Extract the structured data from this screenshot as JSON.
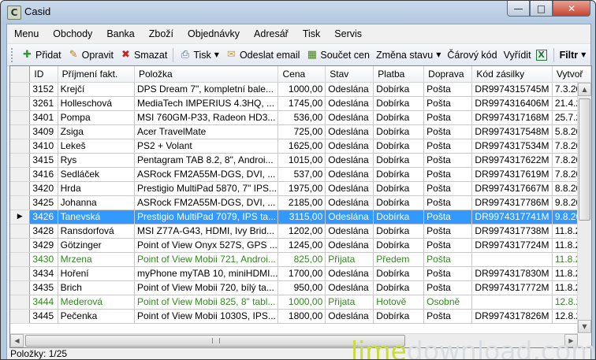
{
  "window": {
    "title": "Casid",
    "app_icon": "C",
    "controls": [
      "minimize-icon",
      "maximize-icon",
      "close-icon"
    ]
  },
  "menu": [
    "Menu",
    "Obchody",
    "Banka",
    "Zboží",
    "Objednávky",
    "Adresář",
    "Tisk",
    "Servis"
  ],
  "toolbar": {
    "add": "Přidat",
    "edit": "Opravit",
    "delete": "Smazat",
    "print": "Tisk",
    "send_email": "Odeslat email",
    "sum_prices": "Součet cen",
    "change_state": "Změna stavu",
    "barcode": "Čárový kód",
    "resolve": "Vyřídit",
    "filter": "Filtr"
  },
  "columns": [
    "ID",
    "Příjmení fakt.",
    "Položka",
    "Cena",
    "Stav",
    "Platba",
    "Doprava",
    "Kód zásilky",
    "Vytvoř"
  ],
  "rows": [
    [
      "3152",
      "Krejčí",
      "DPS Dream 7\", kompletní bale...",
      "1000,00",
      "Odeslána",
      "Dobírka",
      "Pošta",
      "DR9974315745M",
      "7.3.201"
    ],
    [
      "3261",
      "Holleschová",
      "MediaTech IMPERIUS 4.3HQ, ...",
      "1745,00",
      "Odeslána",
      "Dobírka",
      "Pošta",
      "DR9974316406M",
      "21.4.20"
    ],
    [
      "3401",
      "Pompa",
      "MSI 760GM-P33, Radeon HD3...",
      "536,00",
      "Odeslána",
      "Dobírka",
      "Pošta",
      "DR9974317168M",
      "25.7.20"
    ],
    [
      "3409",
      "Zsiga",
      "Acer TravelMate",
      "725,00",
      "Odeslána",
      "Dobírka",
      "Pošta",
      "DR9974317548M",
      "5.8.201"
    ],
    [
      "3410",
      "Lekeš",
      "PS2 + Volant",
      "1625,00",
      "Odeslána",
      "Dobírka",
      "Pošta",
      "DR9974317534M",
      "7.8.201"
    ],
    [
      "3415",
      "Rys",
      "Pentagram TAB 8.2, 8\", Androi...",
      "1015,00",
      "Odeslána",
      "Dobírka",
      "Pošta",
      "DR9974317622M",
      "7.8.201"
    ],
    [
      "3416",
      "Sedláček",
      "ASRock FM2A55M-DGS, DVI, ...",
      "537,00",
      "Odeslána",
      "Dobírka",
      "Pošta",
      "DR9974317619M",
      "7.8.201"
    ],
    [
      "3420",
      "Hrda",
      "Prestigio MultiPad 5870, 7\" IPS...",
      "1975,00",
      "Odeslána",
      "Dobírka",
      "Pošta",
      "DR9974317667M",
      "8.8.201"
    ],
    [
      "3425",
      "Johanna",
      "ASRock FM2A55M-DGS, DVI, ...",
      "2185,00",
      "Odeslána",
      "Dobírka",
      "Pošta",
      "DR9974317786M",
      "9.8.201"
    ],
    [
      "3426",
      "Tanevská",
      "Prestigio MultiPad 7079, IPS ta...",
      "3115,00",
      "Odeslána",
      "Dobírka",
      "Pošta",
      "DR9974317741M",
      "9.8.201"
    ],
    [
      "3428",
      "Ransdorfová",
      "MSI Z77A-G43, HDMI, Ivy Brid...",
      "1202,00",
      "Odeslána",
      "Dobírka",
      "Pošta",
      "DR9974317738M",
      "11.8.20"
    ],
    [
      "3429",
      "Götzinger",
      "Point of View Onyx 527S, GPS ...",
      "1245,00",
      "Odeslána",
      "Dobírka",
      "Pošta",
      "DR9974317724M",
      "11.8.20"
    ],
    [
      "3430",
      "Mrzena",
      "Point of View Mobii 721, Androi...",
      "825,00",
      "Přijata",
      "Předem",
      "Pošta",
      "",
      "11.8.20"
    ],
    [
      "3434",
      "Hoření",
      "myPhone myTAB 10, miniHDMI...",
      "1700,00",
      "Odeslána",
      "Dobírka",
      "Pošta",
      "DR9974317830M",
      "11.8.20"
    ],
    [
      "3435",
      "Brich",
      "Point of View Mobii 720, bílý ta...",
      "950,00",
      "Odeslána",
      "Dobírka",
      "Pošta",
      "DR9974317772M",
      "11.8.20"
    ],
    [
      "3444",
      "Mederová",
      "Point of View Mobii 825, 8\" tabl...",
      "1000,00",
      "Přijata",
      "Hotově",
      "Osobně",
      "",
      "12.8.20"
    ],
    [
      "3445",
      "Pečenka",
      "Point of View Mobii 1030S, IPS...",
      "1800,00",
      "Odeslána",
      "Dobírka",
      "Pošta",
      "DR9974317826M",
      "12.8.20"
    ]
  ],
  "selected_row_index": 9,
  "green_row_indices": [
    12,
    15
  ],
  "status": {
    "label": "Položky:",
    "value": "1/25"
  },
  "watermark": {
    "part1": "lime",
    "part2": "download.com"
  },
  "colors": {
    "selection": "#3399ff",
    "pending_text": "#2e8b1a",
    "accent_red": "#c8432f"
  }
}
